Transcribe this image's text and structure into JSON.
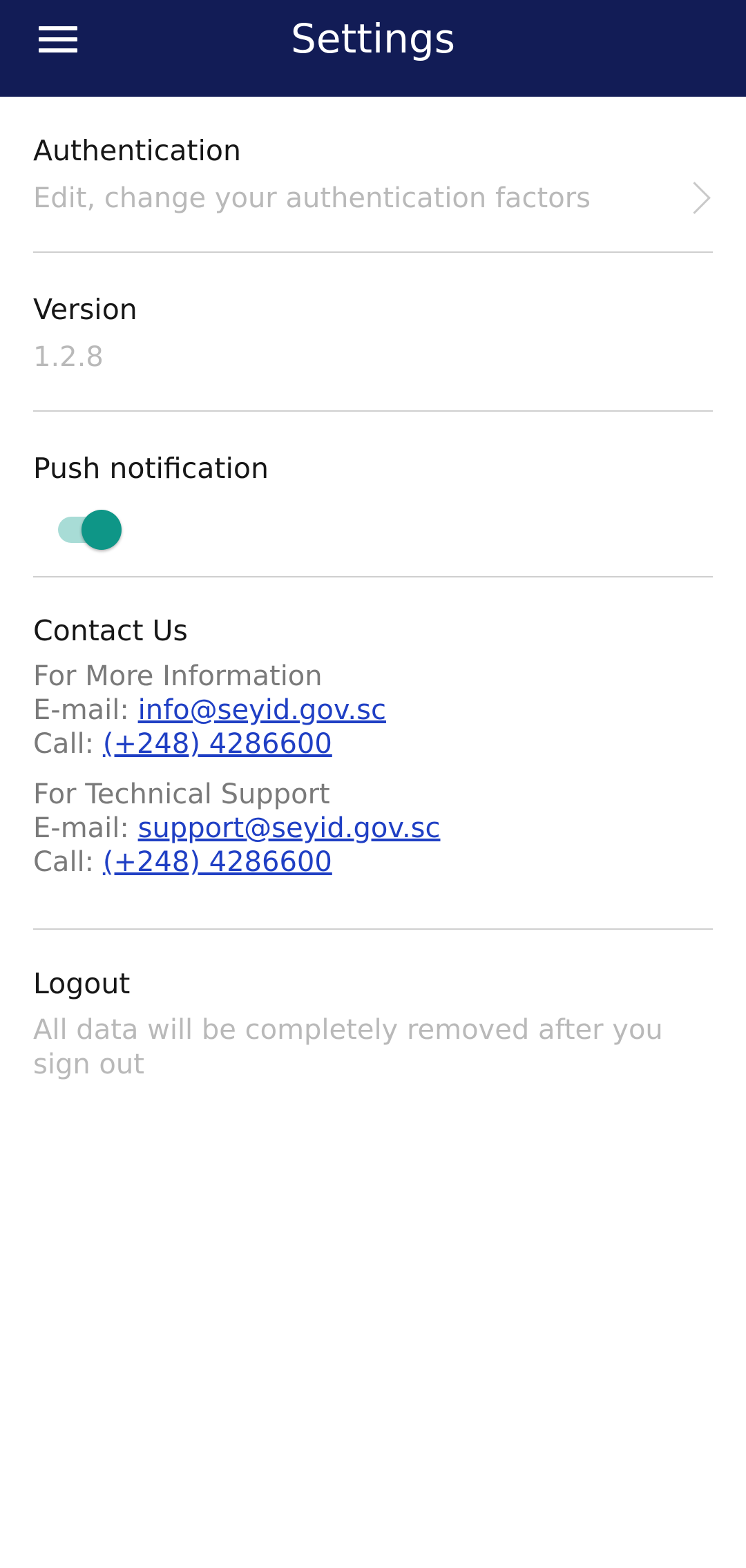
{
  "appbar": {
    "title": "Settings",
    "menu_icon": "hamburger-menu-icon",
    "background_color": "#121c56"
  },
  "authentication": {
    "title": "Authentication",
    "subtitle": "Edit, change your authentication factors",
    "chevron_icon": "chevron-right-icon"
  },
  "version": {
    "title": "Version",
    "value": "1.2.8"
  },
  "push_notification": {
    "title": "Push notification",
    "enabled": true,
    "accent_color": "#0e9687"
  },
  "contact": {
    "title": "Contact Us",
    "info": {
      "heading": "For More Information",
      "email_label": "E-mail: ",
      "email": "info@seyid.gov.sc",
      "call_label": "Call: ",
      "phone": "(+248) 4286600"
    },
    "support": {
      "heading": "For Technical Support",
      "email_label": "E-mail: ",
      "email": "support@seyid.gov.sc",
      "call_label": "Call: ",
      "phone": "(+248) 4286600"
    },
    "link_color": "#1f3fc4"
  },
  "logout": {
    "title": "Logout",
    "subtitle": "All data will be completely removed after you sign out"
  }
}
